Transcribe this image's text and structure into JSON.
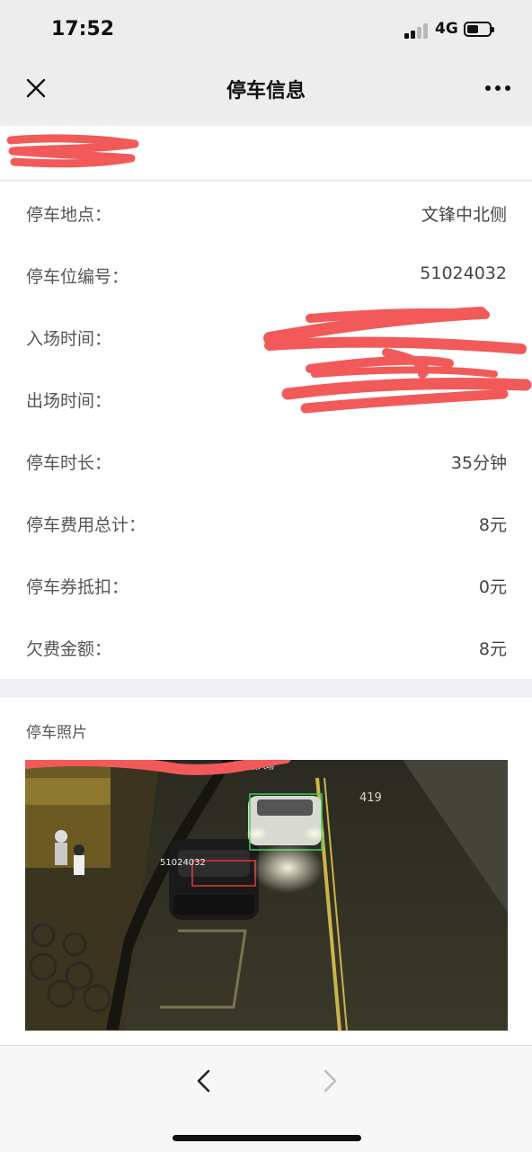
{
  "status": {
    "time": "17:52",
    "network": "4G"
  },
  "nav": {
    "title": "停车信息",
    "close_icon": "close-icon",
    "more_icon": "more-dots-icon"
  },
  "info": {
    "rows": [
      {
        "label": "停车地点：",
        "value": "文锋中北侧"
      },
      {
        "label": "停车位编号：",
        "value": "51024032"
      },
      {
        "label": "入场时间：",
        "value": ""
      },
      {
        "label": "出场时间：",
        "value": ""
      },
      {
        "label": "停车时长：",
        "value": "35分钟"
      },
      {
        "label": "停车费用总计：",
        "value": "8元"
      },
      {
        "label": "停车券抵扣：",
        "value": "0元"
      },
      {
        "label": "欠费金额：",
        "value": "8元"
      }
    ]
  },
  "photo": {
    "title": "停车照片",
    "plate_text": "51024032",
    "overlay_text": "驶入场",
    "road_marking": "419"
  },
  "toolbar": {
    "back_icon": "chevron-left-icon",
    "forward_icon": "chevron-right-icon"
  },
  "colors": {
    "redaction": "#f25a5a",
    "background": "#efeff4",
    "card": "#ffffff"
  }
}
